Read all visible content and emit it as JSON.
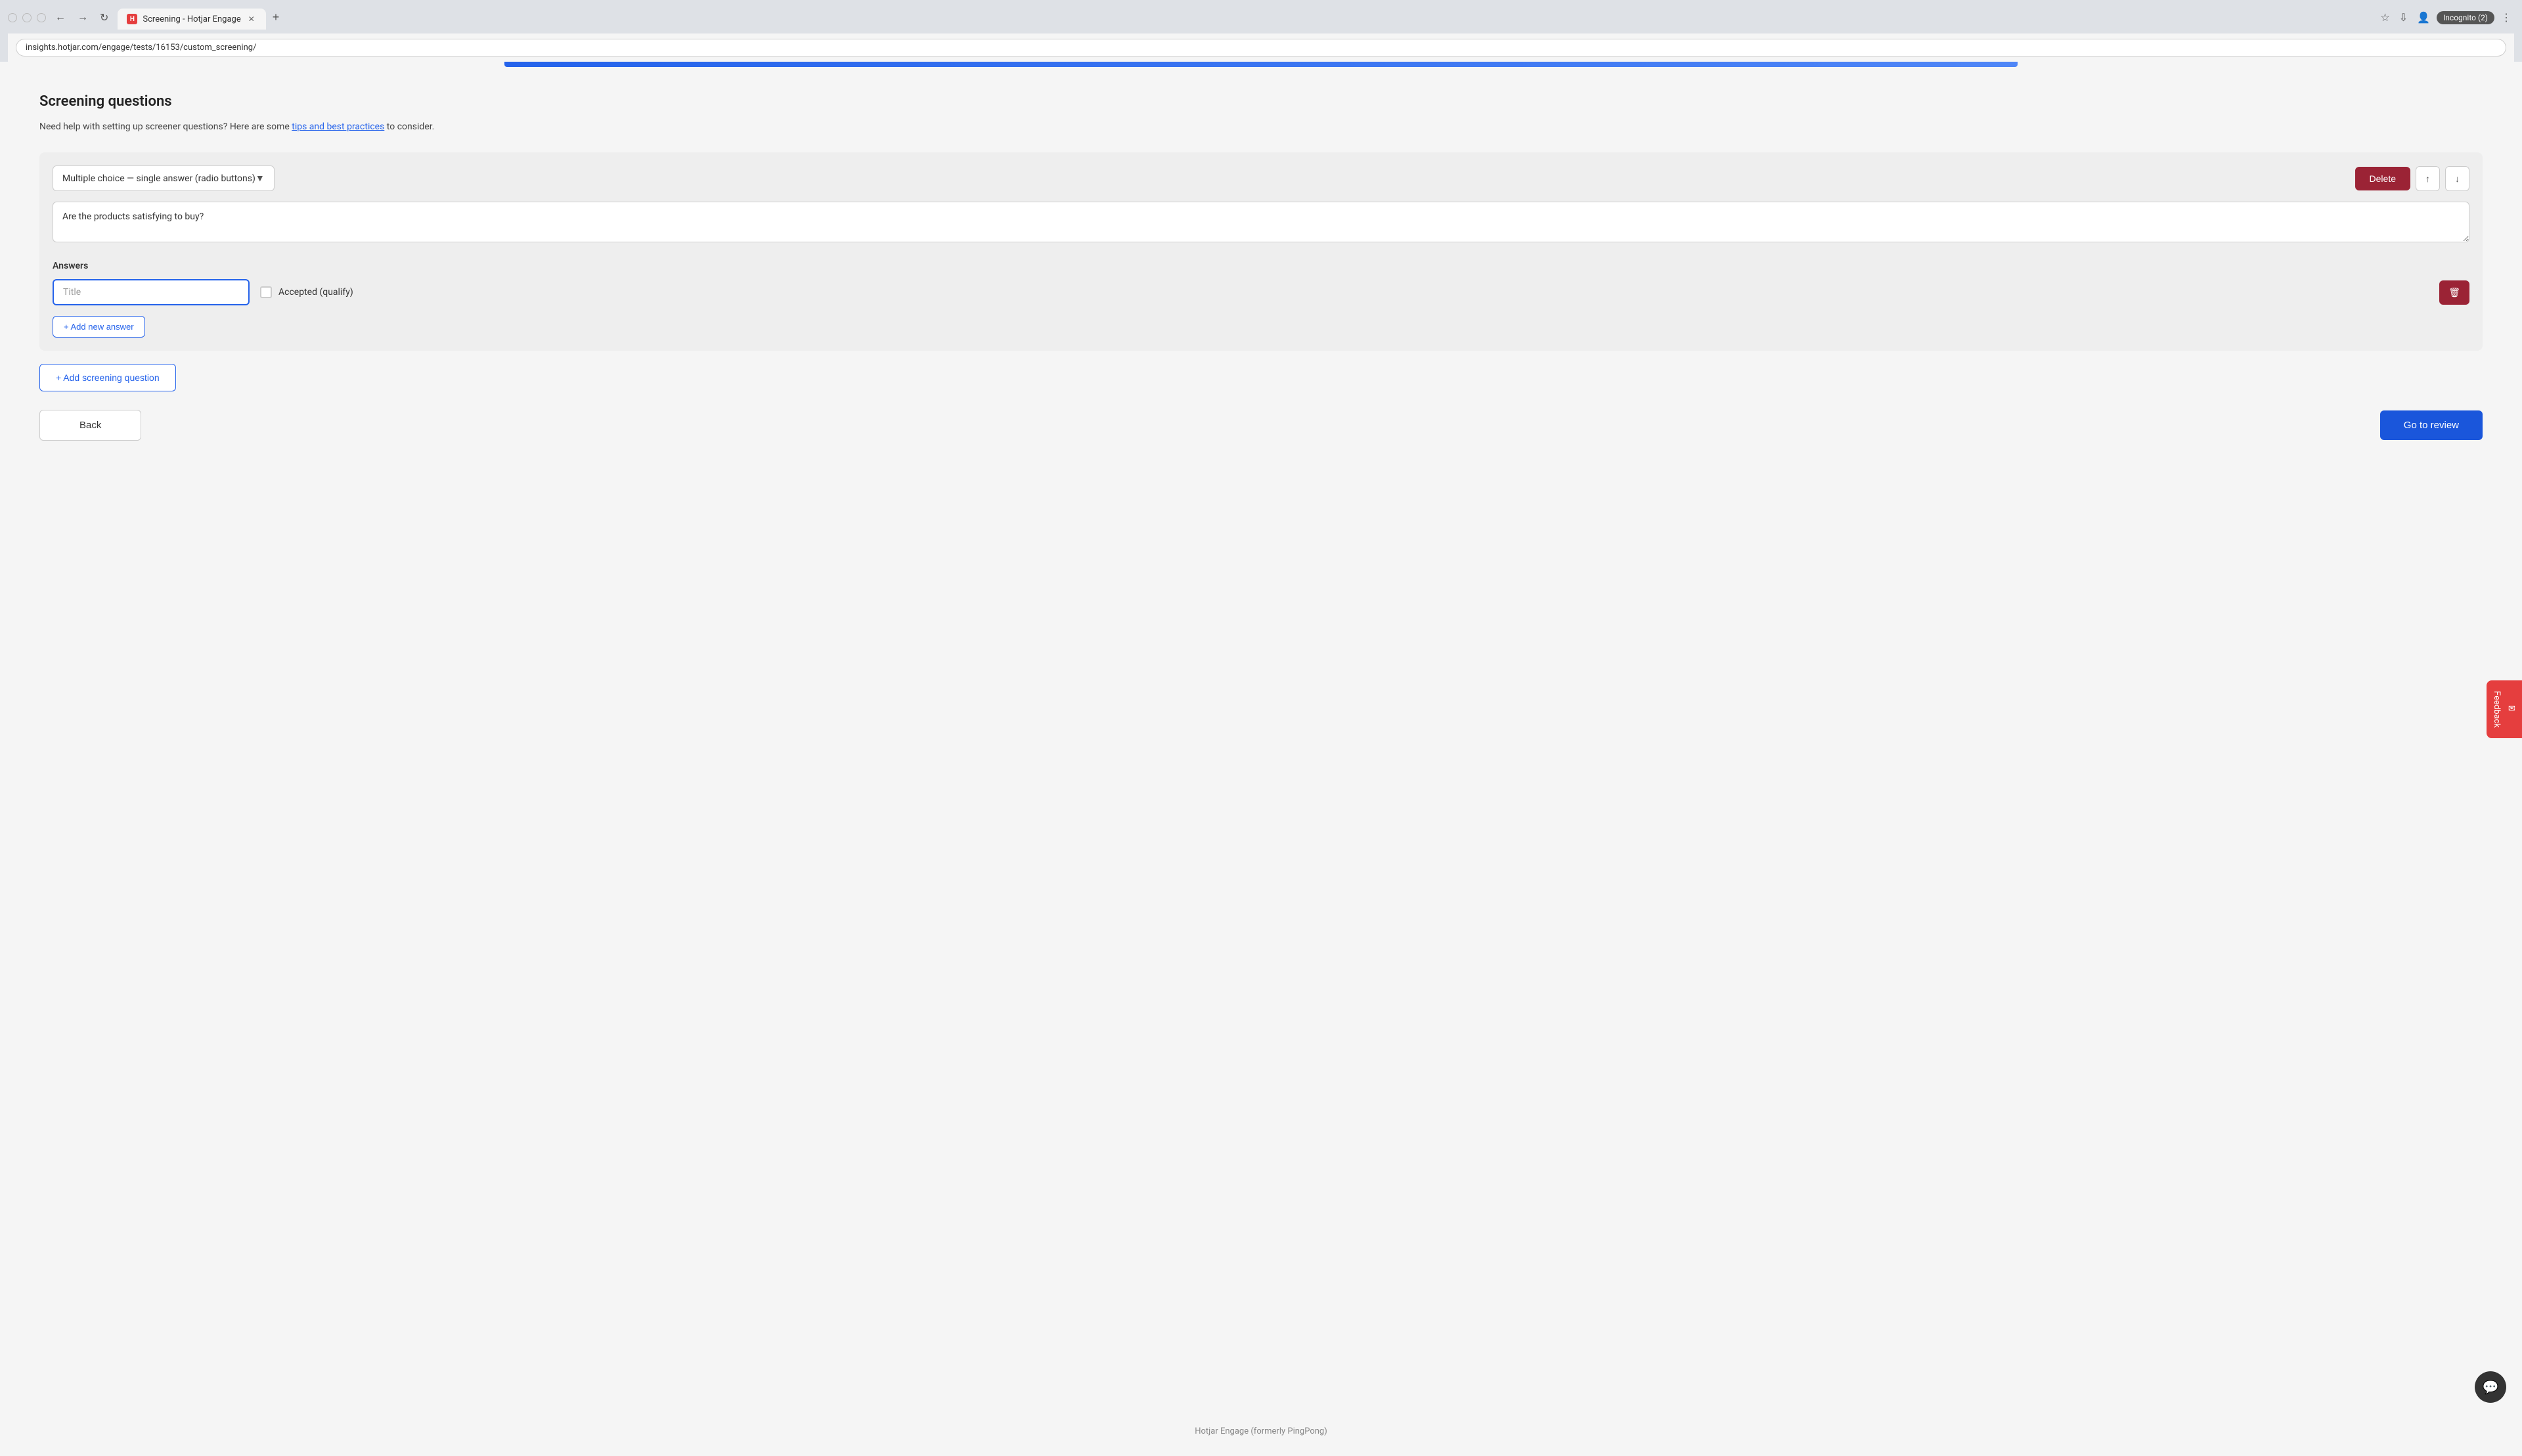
{
  "browser": {
    "tab_title": "Screening - Hotjar Engage",
    "url": "insights.hotjar.com/engage/tests/16153/custom_screening/",
    "incognito_label": "Incognito (2)",
    "new_tab_symbol": "+"
  },
  "page": {
    "section_title": "Screening questions",
    "help_text_before_link": "Need help with setting up screener questions? Here are some ",
    "help_link_text": "tips and best practices",
    "help_text_after_link": " to consider."
  },
  "question_card": {
    "type_label": "Multiple choice — single answer (radio buttons)",
    "delete_btn_label": "Delete",
    "question_text": "Are the products satisfying to buy?",
    "answers_label": "Answers",
    "answer_placeholder": "Title",
    "accepted_qualify_label": "Accepted (qualify)",
    "add_answer_label": "+ Add new answer"
  },
  "bottom": {
    "add_question_label": "+ Add screening question",
    "back_label": "Back",
    "go_to_review_label": "Go to review"
  },
  "footer": {
    "text": "Hotjar Engage (formerly PingPong)"
  },
  "feedback": {
    "label": "Feedback"
  },
  "colors": {
    "delete_red": "#9b2335",
    "link_blue": "#2563eb",
    "review_blue": "#1a56db"
  }
}
